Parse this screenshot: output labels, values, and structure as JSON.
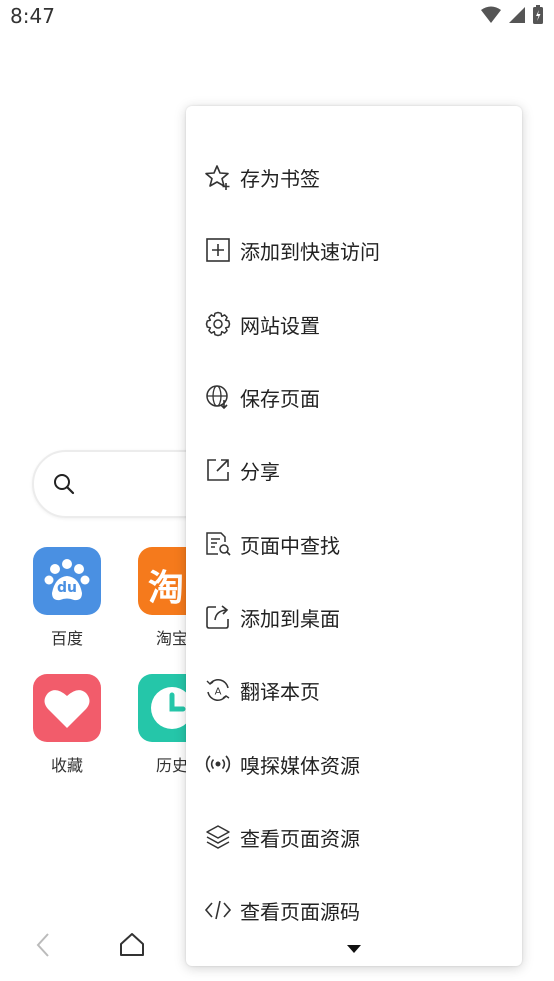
{
  "status_bar": {
    "time": "8:47"
  },
  "search": {
    "placeholder": ""
  },
  "shortcuts": [
    {
      "label": "百度",
      "color": "#4a90e2",
      "icon": "baidu-icon",
      "glyph": "du"
    },
    {
      "label": "淘宝",
      "color": "#f57a1c",
      "icon": "taobao-icon",
      "glyph": "淘"
    },
    {
      "label": "收藏",
      "color": "#f25c6b",
      "icon": "heart-icon"
    },
    {
      "label": "历史",
      "color": "#25c6a9",
      "icon": "clock-icon"
    }
  ],
  "menu": {
    "items": [
      {
        "label": "存为书签",
        "icon": "star-add-icon"
      },
      {
        "label": "添加到快速访问",
        "icon": "plus-square-icon"
      },
      {
        "label": "网站设置",
        "icon": "gear-icon"
      },
      {
        "label": "保存页面",
        "icon": "globe-download-icon"
      },
      {
        "label": "分享",
        "icon": "share-icon"
      },
      {
        "label": "页面中查找",
        "icon": "find-in-page-icon"
      },
      {
        "label": "添加到桌面",
        "icon": "add-to-desktop-icon"
      },
      {
        "label": "翻译本页",
        "icon": "translate-icon"
      },
      {
        "label": "嗅探媒体资源",
        "icon": "sniff-media-icon"
      },
      {
        "label": "查看页面资源",
        "icon": "layers-icon"
      },
      {
        "label": "查看页面源码",
        "icon": "code-icon"
      }
    ],
    "more_icon": "triangle-down-icon"
  },
  "bottom_nav": {
    "icons": [
      "back-icon",
      "home-icon"
    ]
  }
}
